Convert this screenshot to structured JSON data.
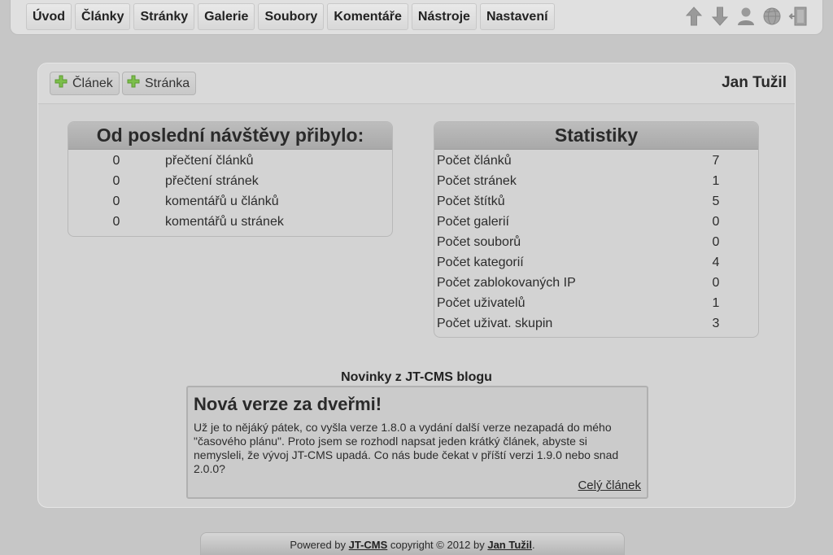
{
  "nav": {
    "items": [
      "Úvod",
      "Články",
      "Stránky",
      "Galerie",
      "Soubory",
      "Komentáře",
      "Nástroje",
      "Nastavení"
    ],
    "icons": [
      "arrow-up-icon",
      "arrow-down-icon",
      "user-icon",
      "globe-icon",
      "logout-door-icon"
    ]
  },
  "toolbar": {
    "add_article_label": "Článek",
    "add_page_label": "Stránka",
    "user_name": "Jan Tužil"
  },
  "since_last_visit": {
    "title": "Od poslední návštěvy přibylo:",
    "rows": [
      {
        "value": "0",
        "label": "přečtení článků"
      },
      {
        "value": "0",
        "label": "přečtení stránek"
      },
      {
        "value": "0",
        "label": "komentářů u článků"
      },
      {
        "value": "0",
        "label": "komentářů u stránek"
      }
    ]
  },
  "statistics": {
    "title": "Statistiky",
    "rows": [
      {
        "label": "Počet článků",
        "value": "7"
      },
      {
        "label": "Počet stránek",
        "value": "1"
      },
      {
        "label": "Počet štítků",
        "value": "5"
      },
      {
        "label": "Počet galerií",
        "value": "0"
      },
      {
        "label": "Počet souborů",
        "value": "0"
      },
      {
        "label": "Počet kategorií",
        "value": "4"
      },
      {
        "label": "Počet zablokovaných IP",
        "value": "0"
      },
      {
        "label": "Počet uživatelů",
        "value": "1"
      },
      {
        "label": "Počet uživat. skupin",
        "value": "3"
      }
    ]
  },
  "news": {
    "heading": "Novinky z JT-CMS blogu",
    "title": "Nová verze za dveřmi!",
    "text": "Už je to nějáký pátek, co vyšla verze 1.8.0 a vydání další verze nezapadá do mého \"časového plánu\". Proto jsem se rozhodl napsat jeden krátký článek, abyste si nemysleli, že vývoj JT-CMS upadá. Co nás bude čekat v příští verzi 1.9.0 nebo snad 2.0.0?",
    "link_label": "Celý článek"
  },
  "footer": {
    "prefix": "Powered by ",
    "cms_link": "JT-CMS",
    "middle": " copyright © 2012 by ",
    "author_link": "Jan Tužil",
    "suffix": "."
  },
  "colors": {
    "background": "#c6c6c6",
    "panel": "#d3d3d3",
    "plus_icon": "#7cbf4a"
  }
}
